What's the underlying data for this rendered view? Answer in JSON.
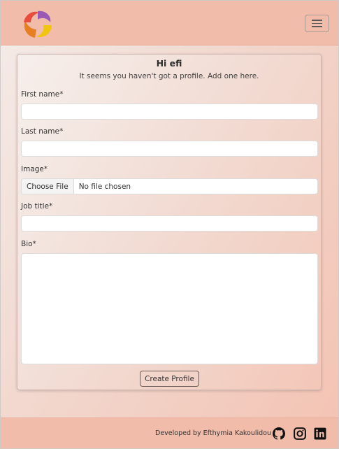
{
  "navbar": {
    "logo": "swirl-logo",
    "menu_icon": "hamburger-icon"
  },
  "profile_form": {
    "greeting": "Hi efi",
    "subtitle": "It seems you haven't got a profile. Add one here.",
    "first_name_label": "First name*",
    "first_name_value": "",
    "last_name_label": "Last name*",
    "last_name_value": "",
    "image_label": "Image*",
    "file_button_label": "Choose File",
    "file_status": "No file chosen",
    "job_title_label": "Job title*",
    "job_title_value": "",
    "bio_label": "Bio*",
    "bio_value": "",
    "submit_label": "Create Profile"
  },
  "footer": {
    "developer_text": "Developed by Efthymia Kakoulidou",
    "social_icons": [
      "github-icon",
      "instagram-icon",
      "linkedin-icon"
    ]
  },
  "colors": {
    "navbar_bg": "#f2bcab",
    "footer_bg": "#f2bcab"
  }
}
